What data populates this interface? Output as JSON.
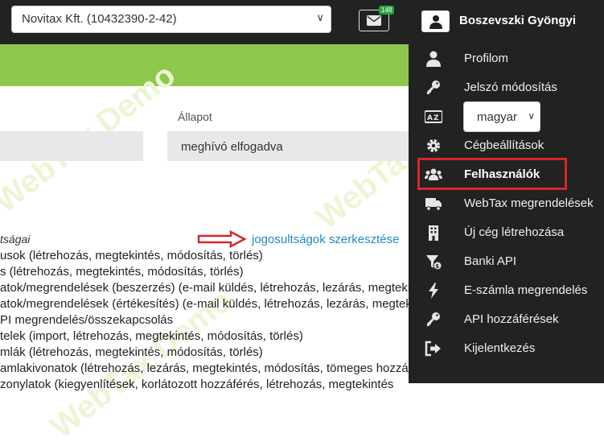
{
  "header": {
    "company_select": "Novitax Kft. (10432390-2-42)",
    "mail_badge": "148",
    "user_name": "Boszevszki Gyöngyi"
  },
  "watermarks": [
    "WebTax Demo",
    "WebTax Demo",
    "WebTax Demo"
  ],
  "form": {
    "status_label": "Állapot",
    "status_value": "meghívó elfogadva"
  },
  "permissions": {
    "title": "tságai",
    "edit_link": "jogosultságok szerkesztése",
    "lines": [
      "usok (létrehozás, megtekintés, módosítás, törlés)",
      "s (létrehozás, megtekintés, módosítás, törlés)",
      "atok/megrendelések (beszerzés) (e-mail küldés, létrehozás, lezárás, megtekintés",
      "atok/megrendelések (értékesítés) (e-mail küldés, létrehozás, lezárás, megtekintés",
      "PI megrendelés/összekapcsolás",
      "telek (import, létrehozás, megtekintés, módosítás, törlés)",
      "mlák (létrehozás, megtekintés, módosítás, törlés)",
      "amlakivonatok (létrehozás, lezárás, megtekintés, módosítás, tömeges hozzáférés",
      "zonylatok (kiegyenlítések, korlátozott hozzáférés, létrehozás, megtekintés"
    ]
  },
  "menu": {
    "items": [
      {
        "label": "Profilom",
        "icon": "user-icon"
      },
      {
        "label": "Jelszó módosítás",
        "icon": "key-icon"
      },
      {
        "label": "",
        "icon": "language-icon"
      },
      {
        "label": "Cégbeállítások",
        "icon": "gear-icon"
      },
      {
        "label": "Felhasználók",
        "icon": "users-icon"
      },
      {
        "label": "WebTax megrendelések",
        "icon": "truck-icon"
      },
      {
        "label": "Új cég létrehozása",
        "icon": "building-icon"
      },
      {
        "label": "Banki API",
        "icon": "bank-icon"
      },
      {
        "label": "E-számla megrendelés",
        "icon": "bolt-icon"
      },
      {
        "label": "API hozzáférések",
        "icon": "key-icon"
      },
      {
        "label": "Kijelentkezés",
        "icon": "sign-out-icon"
      }
    ],
    "language_select": "magyar"
  },
  "colors": {
    "topbar": "#222222",
    "accent_green": "#8dc84c",
    "link_blue": "#1e88c8",
    "highlight_red": "#d8262a"
  }
}
